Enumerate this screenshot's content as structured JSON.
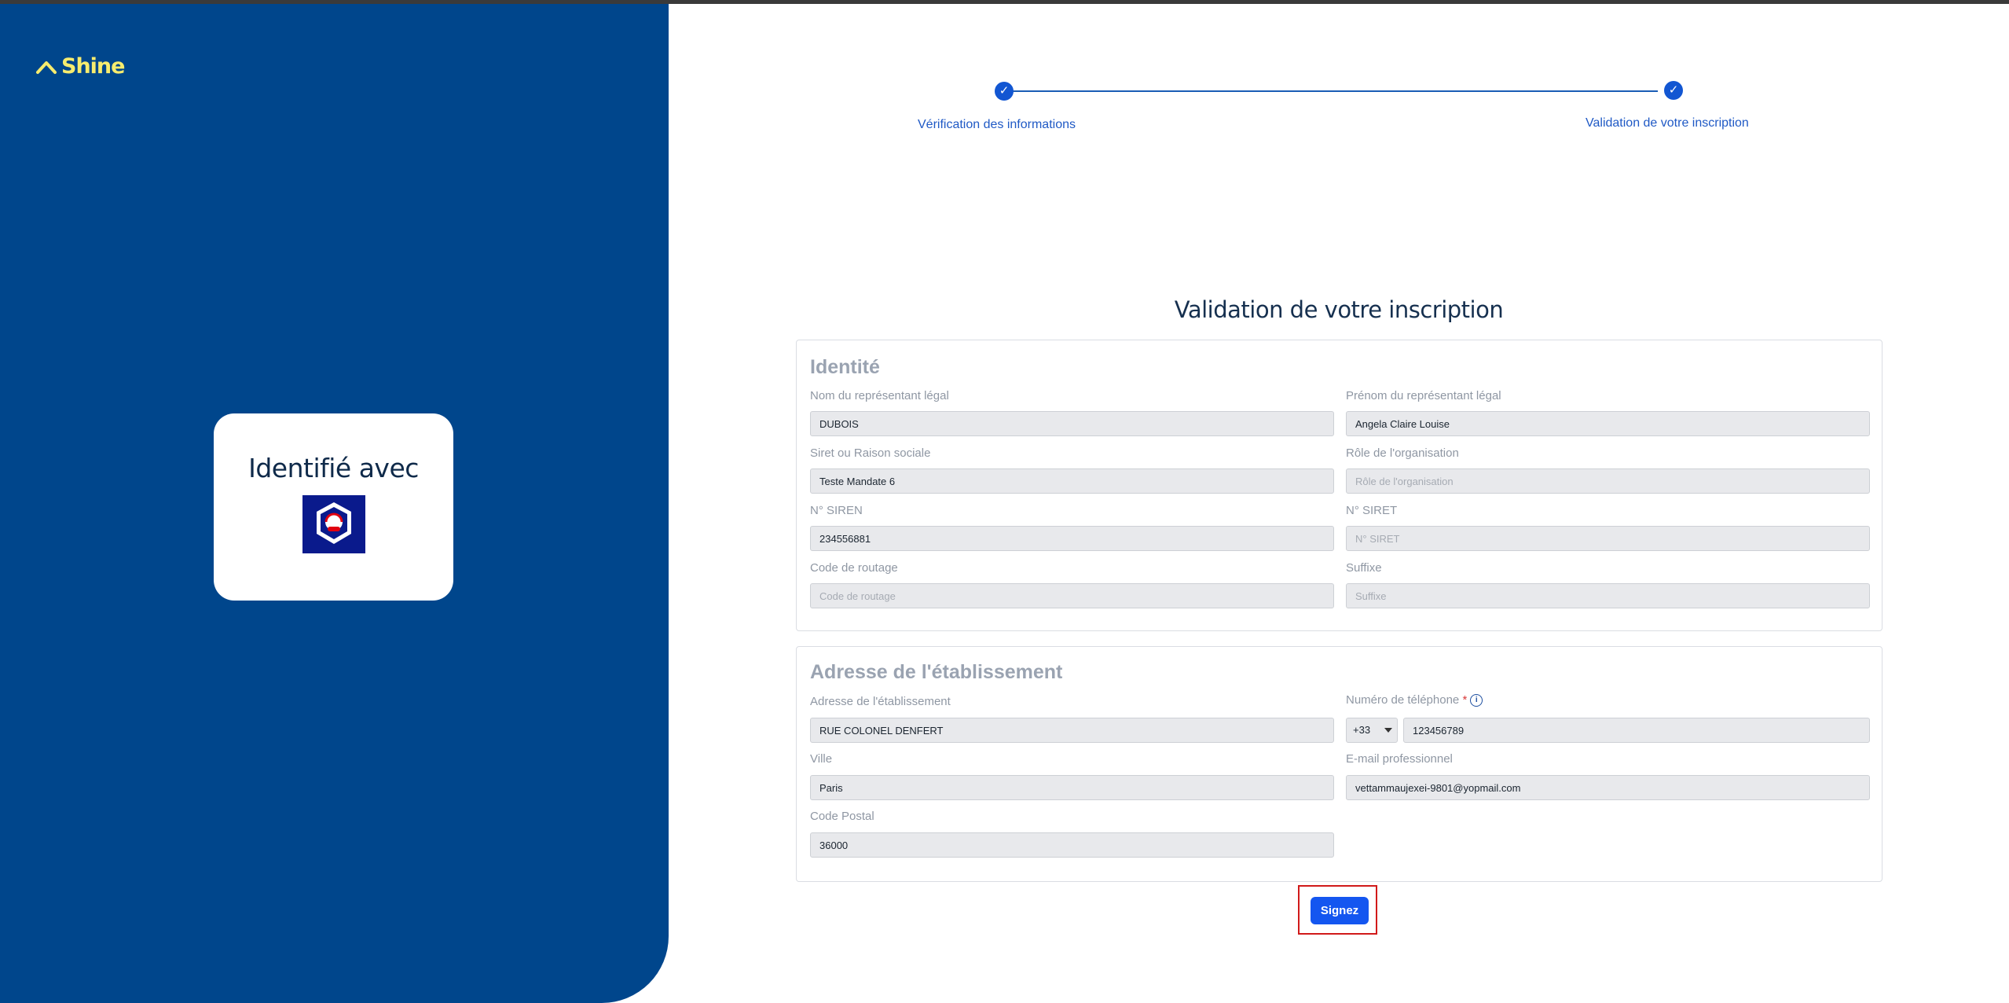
{
  "brand": {
    "name": "Shine",
    "accent": "#f7ec6e",
    "panel_color": "#00468c"
  },
  "id_card": {
    "title": "Identifié avec",
    "logo_icon": "franceconnect-logo"
  },
  "stepper": {
    "steps": [
      {
        "label": "Vérification des informations",
        "status": "done"
      },
      {
        "label": "Validation de votre inscription",
        "status": "done"
      }
    ],
    "check_glyph": "✓"
  },
  "page_title": "Validation de votre inscription",
  "identity": {
    "title": "Identité",
    "nom": {
      "label": "Nom du représentant légal",
      "value": "DUBOIS",
      "placeholder": ""
    },
    "prenom": {
      "label": "Prénom du représentant légal",
      "value": "Angela Claire Louise",
      "placeholder": ""
    },
    "siret_raison": {
      "label": "Siret ou Raison sociale",
      "value": "Teste Mandate 6",
      "placeholder": ""
    },
    "role": {
      "label": "Rôle de l'organisation",
      "value": "",
      "placeholder": "Rôle de l'organisation"
    },
    "siren": {
      "label": "N° SIREN",
      "value": "234556881",
      "placeholder": ""
    },
    "siret": {
      "label": "N° SIRET",
      "value": "",
      "placeholder": "N° SIRET"
    },
    "code_routage": {
      "label": "Code de routage",
      "value": "",
      "placeholder": "Code de routage"
    },
    "suffixe": {
      "label": "Suffixe",
      "value": "",
      "placeholder": "Suffixe"
    }
  },
  "address": {
    "title": "Adresse de l'établissement",
    "adresse": {
      "label": "Adresse de l'établissement",
      "value": "RUE COLONEL DENFERT"
    },
    "telephone": {
      "label": "Numéro de téléphone",
      "required_mark": "*",
      "info_glyph": "i",
      "country_code": "+33",
      "value": "123456789"
    },
    "ville": {
      "label": "Ville",
      "value": "Paris"
    },
    "email": {
      "label": "E-mail professionnel",
      "value": "vettammaujexei-9801@yopmail.com"
    },
    "code_postal": {
      "label": "Code Postal",
      "value": "36000"
    }
  },
  "actions": {
    "sign_label": "Signez",
    "highlight_color": "#d11a1a"
  }
}
